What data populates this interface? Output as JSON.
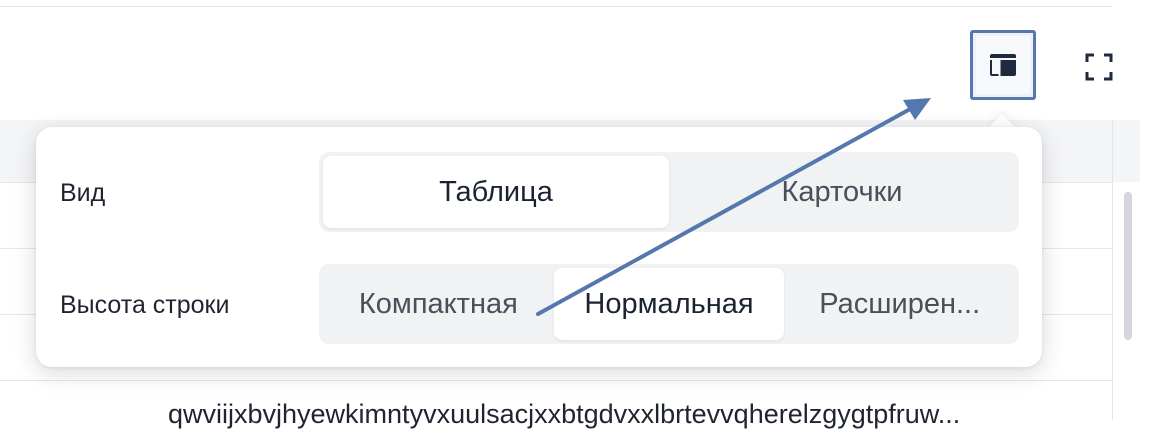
{
  "toolbar": {
    "view_toggle_icon": "table-layout-icon",
    "fullscreen_icon": "fullscreen-icon",
    "accent_color": "#5478ad"
  },
  "popover": {
    "view_row": {
      "label": "Вид",
      "options": [
        "Таблица",
        "Карточки"
      ],
      "selected": "Таблица"
    },
    "row_height_row": {
      "label": "Высота строки",
      "options": [
        "Компактная",
        "Нормальная",
        "Расширен..."
      ],
      "selected": "Нормальная"
    }
  },
  "table": {
    "cell_text": "qwviijxbvjhyewkimntyvxuulsacjxxbtgdvxxlbrtevvqherelzgygtpfruw..."
  },
  "annotation": {
    "arrow_color": "#5478ad"
  }
}
